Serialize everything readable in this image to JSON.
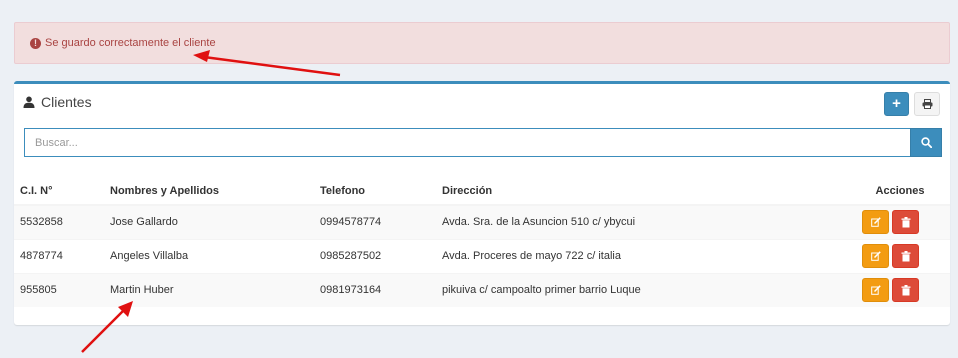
{
  "alert": {
    "message": "Se guardo correctamente el cliente",
    "icon": "exclamation-circle-icon",
    "color": "#a94442",
    "background": "#f2dede"
  },
  "box": {
    "title": "Clientes",
    "title_icon": "user-icon",
    "add_label": "+",
    "print_icon": "print-icon",
    "accent": "#3c8dbc"
  },
  "search": {
    "placeholder": "Buscar...",
    "value": "",
    "button_icon": "search-icon"
  },
  "table": {
    "columns": [
      "C.I. N°",
      "Nombres y Apellidos",
      "Telefono",
      "Dirección",
      "Acciones"
    ],
    "rows": [
      {
        "ci": "5532858",
        "name": "Jose Gallardo",
        "phone": "0994578774",
        "address": "Avda. Sra. de la Asuncion 510 c/ ybycui"
      },
      {
        "ci": "4878774",
        "name": "Angeles Villalba",
        "phone": "0985287502",
        "address": "Avda. Proceres de mayo 722 c/ italia"
      },
      {
        "ci": "955805",
        "name": "Martin Huber",
        "phone": "0981973164",
        "address": "pikuiva c/ campoalto primer barrio Luque"
      }
    ],
    "action_icons": [
      "edit-icon",
      "trash-icon"
    ],
    "action_colors": {
      "edit": "#f39c12",
      "delete": "#dd4b39"
    }
  },
  "annotation_color": "#e01010"
}
